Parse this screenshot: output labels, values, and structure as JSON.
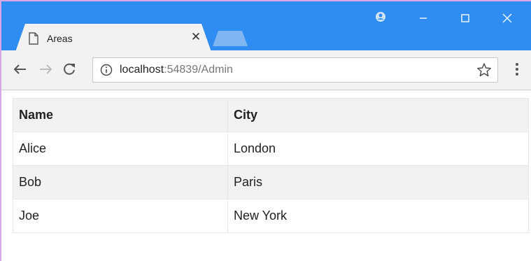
{
  "browser": {
    "tab": {
      "title": "Areas"
    },
    "address_bar": {
      "host": "localhost",
      "rest": ":54839/Admin"
    }
  },
  "table": {
    "headers": [
      "Name",
      "City"
    ],
    "rows": [
      [
        "Alice",
        "London"
      ],
      [
        "Bob",
        "Paris"
      ],
      [
        "Joe",
        "New York"
      ]
    ]
  },
  "colors": {
    "titlebar": "#2f8cf1",
    "toolbar": "#f2f2f2",
    "row_shade": "#f2f2f2"
  }
}
